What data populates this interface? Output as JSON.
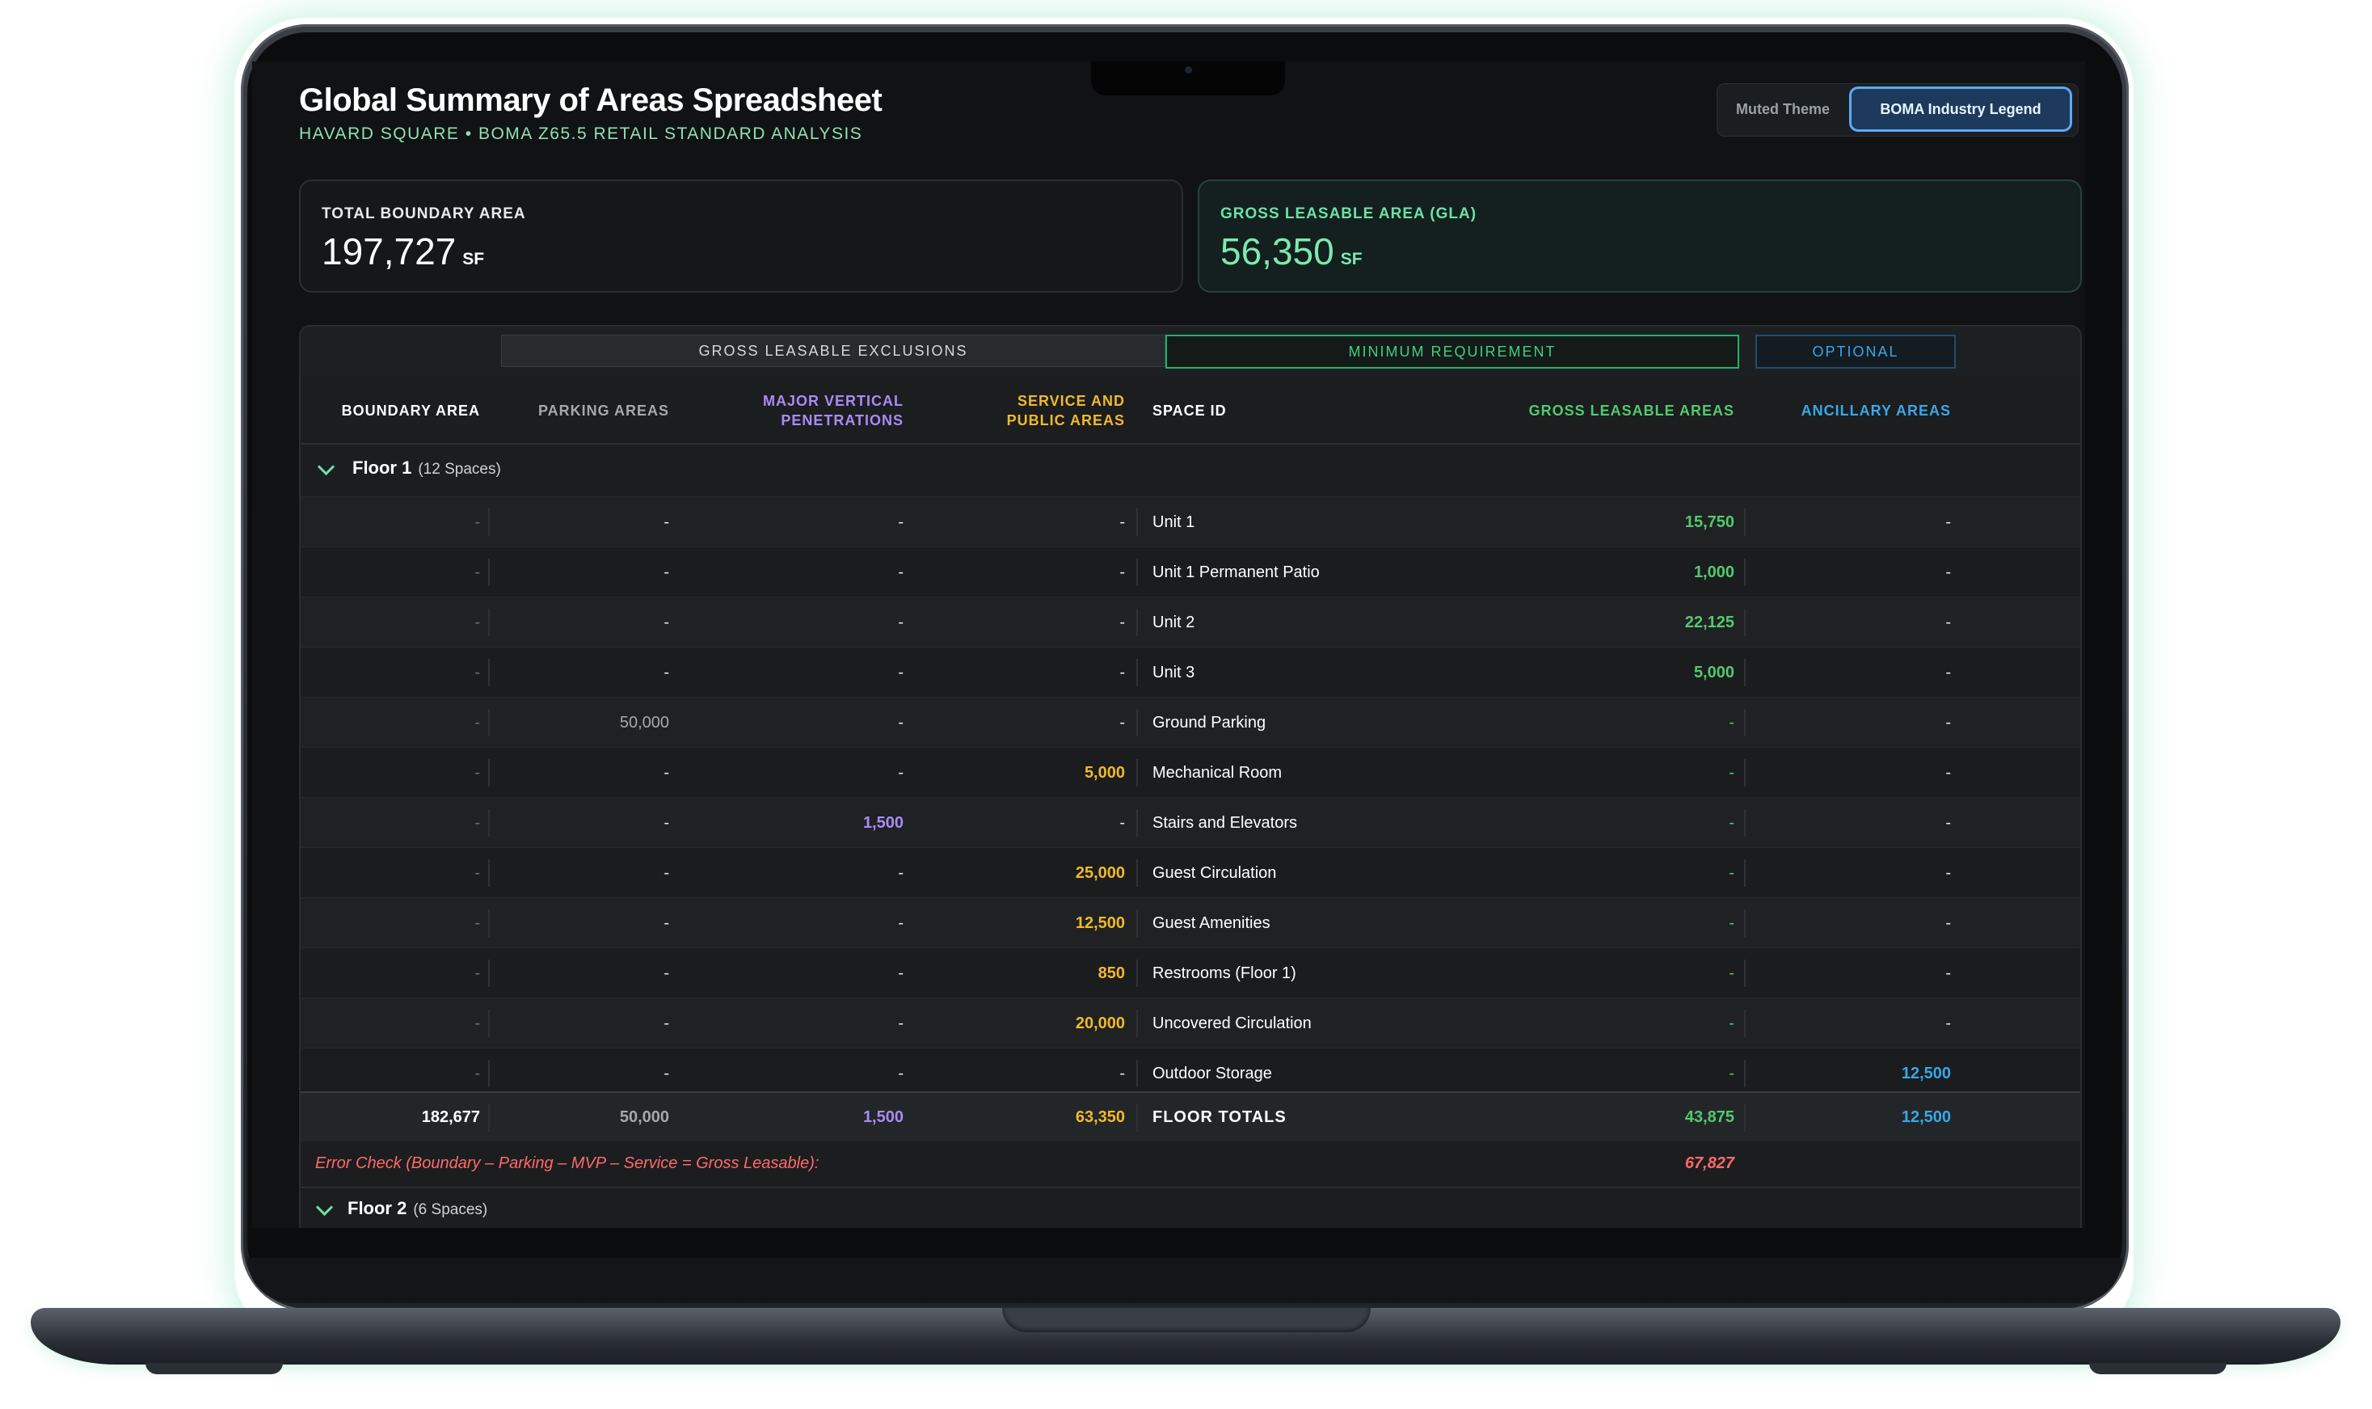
{
  "header": {
    "title": "Global Summary of Areas Spreadsheet",
    "subtitle": "HAVARD SQUARE • BOMA Z65.5 RETAIL STANDARD ANALYSIS"
  },
  "theme_toggle": {
    "muted_label": "Muted Theme",
    "boma_label": "BOMA Industry Legend",
    "selected": "BOMA Industry Legend"
  },
  "summary": {
    "total_boundary": {
      "label": "TOTAL BOUNDARY AREA",
      "value": "197,727",
      "unit": "SF"
    },
    "gla": {
      "label": "GROSS LEASABLE AREA (GLA)",
      "value": "56,350",
      "unit": "SF"
    }
  },
  "table": {
    "groups": {
      "exclusions": "GROSS LEASABLE EXCLUSIONS",
      "minimum": "MINIMUM REQUIREMENT",
      "optional": "OPTIONAL"
    },
    "columns": {
      "boundary": "BOUNDARY AREA",
      "parking": "PARKING AREAS",
      "mvp": "MAJOR VERTICAL PENETRATIONS",
      "service": "SERVICE AND PUBLIC AREAS",
      "space_id": "SPACE ID",
      "gla": "GROSS LEASABLE AREAS",
      "ancillary": "ANCILLARY AREAS"
    },
    "floor1": {
      "label": "Floor 1",
      "count": "(12 Spaces)",
      "rows": [
        {
          "boundary": "-",
          "parking": "-",
          "mvp": "-",
          "service": "-",
          "space": "Unit 1",
          "gla": "15,750",
          "ancillary": "-"
        },
        {
          "boundary": "-",
          "parking": "-",
          "mvp": "-",
          "service": "-",
          "space": "Unit 1 Permanent Patio",
          "gla": "1,000",
          "ancillary": "-"
        },
        {
          "boundary": "-",
          "parking": "-",
          "mvp": "-",
          "service": "-",
          "space": "Unit 2",
          "gla": "22,125",
          "ancillary": "-"
        },
        {
          "boundary": "-",
          "parking": "-",
          "mvp": "-",
          "service": "-",
          "space": "Unit 3",
          "gla": "5,000",
          "ancillary": "-"
        },
        {
          "boundary": "-",
          "parking": "50,000",
          "mvp": "-",
          "service": "-",
          "space": "Ground Parking",
          "gla": "-",
          "ancillary": "-"
        },
        {
          "boundary": "-",
          "parking": "-",
          "mvp": "-",
          "service": "5,000",
          "space": "Mechanical Room",
          "gla": "-",
          "ancillary": "-"
        },
        {
          "boundary": "-",
          "parking": "-",
          "mvp": "1,500",
          "service": "-",
          "space": "Stairs and Elevators",
          "gla": "-",
          "ancillary": "-"
        },
        {
          "boundary": "-",
          "parking": "-",
          "mvp": "-",
          "service": "25,000",
          "space": "Guest Circulation",
          "gla": "-",
          "ancillary": "-"
        },
        {
          "boundary": "-",
          "parking": "-",
          "mvp": "-",
          "service": "12,500",
          "space": "Guest Amenities",
          "gla": "-",
          "ancillary": "-"
        },
        {
          "boundary": "-",
          "parking": "-",
          "mvp": "-",
          "service": "850",
          "space": "Restrooms (Floor 1)",
          "gla": "-",
          "ancillary": "-"
        },
        {
          "boundary": "-",
          "parking": "-",
          "mvp": "-",
          "service": "20,000",
          "space": "Uncovered Circulation",
          "gla": "-",
          "ancillary": "-"
        },
        {
          "boundary": "-",
          "parking": "-",
          "mvp": "-",
          "service": "-",
          "space": "Outdoor Storage",
          "gla": "-",
          "ancillary": "12,500"
        }
      ],
      "totals": {
        "boundary": "182,677",
        "parking": "50,000",
        "mvp": "1,500",
        "service": "63,350",
        "label": "FLOOR TOTALS",
        "gla": "43,875",
        "ancillary": "12,500"
      },
      "error_check": {
        "label": "Error Check (Boundary – Parking – MVP – Service = Gross Leasable):",
        "value": "67,827"
      }
    },
    "floor2": {
      "label": "Floor 2",
      "count": "(6 Spaces)"
    }
  },
  "colors": {
    "boundary": "#ffffff",
    "parking": "#a4a8ac",
    "mvp": "#a98bf5",
    "service": "#f0b92c",
    "gla": "#52c96e",
    "ancillary": "#38a7e8",
    "error": "#ff6a6a"
  }
}
